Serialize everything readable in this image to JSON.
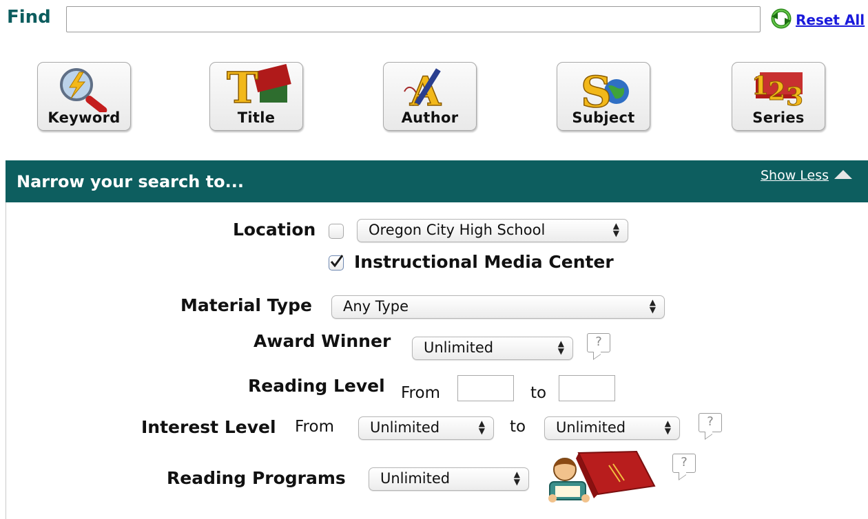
{
  "find": {
    "label": "Find",
    "value": "",
    "reset_label": "Reset All"
  },
  "search_buttons": [
    {
      "label": "Keyword",
      "icon": "magnifier-lightning-icon"
    },
    {
      "label": "Title",
      "icon": "title-t-books-icon"
    },
    {
      "label": "Author",
      "icon": "author-a-pen-icon"
    },
    {
      "label": "Subject",
      "icon": "subject-s-globe-icon"
    },
    {
      "label": "Series",
      "icon": "series-123-books-icon"
    }
  ],
  "narrow": {
    "title": "Narrow your search to...",
    "toggle_label": "Show Less"
  },
  "form": {
    "location": {
      "label": "Location",
      "checked": false,
      "value": "Oregon City High School"
    },
    "imc": {
      "label": "Instructional Media Center",
      "checked": true
    },
    "material_type": {
      "label": "Material Type",
      "value": "Any Type"
    },
    "award_winner": {
      "label": "Award Winner",
      "value": "Unlimited",
      "help": "?"
    },
    "reading_level": {
      "label": "Reading Level",
      "from_label": "From",
      "to_label": "to",
      "from_value": "",
      "to_value": ""
    },
    "interest_level": {
      "label": "Interest Level",
      "from_label": "From",
      "to_label": "to",
      "from_value": "Unlimited",
      "to_value": "Unlimited",
      "help": "?"
    },
    "reading_programs": {
      "label": "Reading Programs",
      "value": "Unlimited",
      "help": "?"
    }
  }
}
